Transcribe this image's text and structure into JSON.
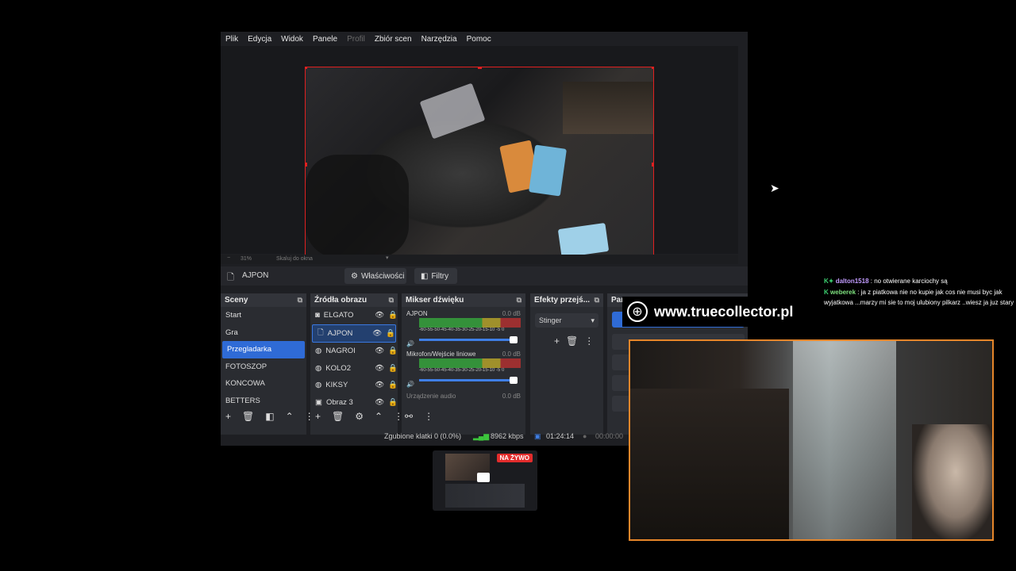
{
  "menu": [
    "Plik",
    "Edycja",
    "Widok",
    "Panele",
    "Profil",
    "Zbiór scen",
    "Narzędzia",
    "Pomoc"
  ],
  "zoom": {
    "percent": "31%",
    "label": "Skaluj do okna"
  },
  "source_bar": {
    "name": "AJPON",
    "properties": "Właściwości",
    "filters": "Filtry"
  },
  "scenes": {
    "title": "Sceny",
    "items": [
      "Start",
      "Gra",
      "Przegladarka",
      "FOTOSZOP",
      "KONCOWA",
      "BETTERS"
    ],
    "selected": 2
  },
  "sources": {
    "title": "Źródła obrazu",
    "items": [
      "ELGATO",
      "AJPON",
      "NAGROI",
      "KOLO2",
      "KIKSY",
      "Obraz 3"
    ],
    "selected": 1
  },
  "mixer": {
    "title": "Mikser dźwięku",
    "channels": [
      {
        "name": "AJPON",
        "db": "0.0 dB"
      },
      {
        "name": "Mikrofon/Wejście liniowe",
        "db": "0.0 dB"
      },
      {
        "name": "Urządzenie audio",
        "db": "0.0 dB"
      }
    ],
    "scale": "-60-55-50-45-40-35-30-25-20-15-10 -5 0"
  },
  "transitions": {
    "title": "Efekty przejś...",
    "selected": "Stinger"
  },
  "controls": {
    "title": "Pan..."
  },
  "status": {
    "dropped": "Zgubione klatki 0 (0.0%)",
    "bitrate": "8962 kbps",
    "stream_time": "01:24:14",
    "rec_time": "00:00:00"
  },
  "overlay": {
    "url": "www.truecollector.pl",
    "live_badge": "NA ŻYWO"
  },
  "chat": [
    {
      "user": "dalton1518",
      "user_color": "#c29cff",
      "text": ": no otwierane karciochy są"
    },
    {
      "user": "weberek",
      "user_color": "#7ee07e",
      "text": ": ja z piatkowa nie no kupie jak cos nie musi byc jak wyjatkowa ...marzy mi sie to moj ulubiony pilkarz ..wiesz ja juz stary"
    }
  ]
}
